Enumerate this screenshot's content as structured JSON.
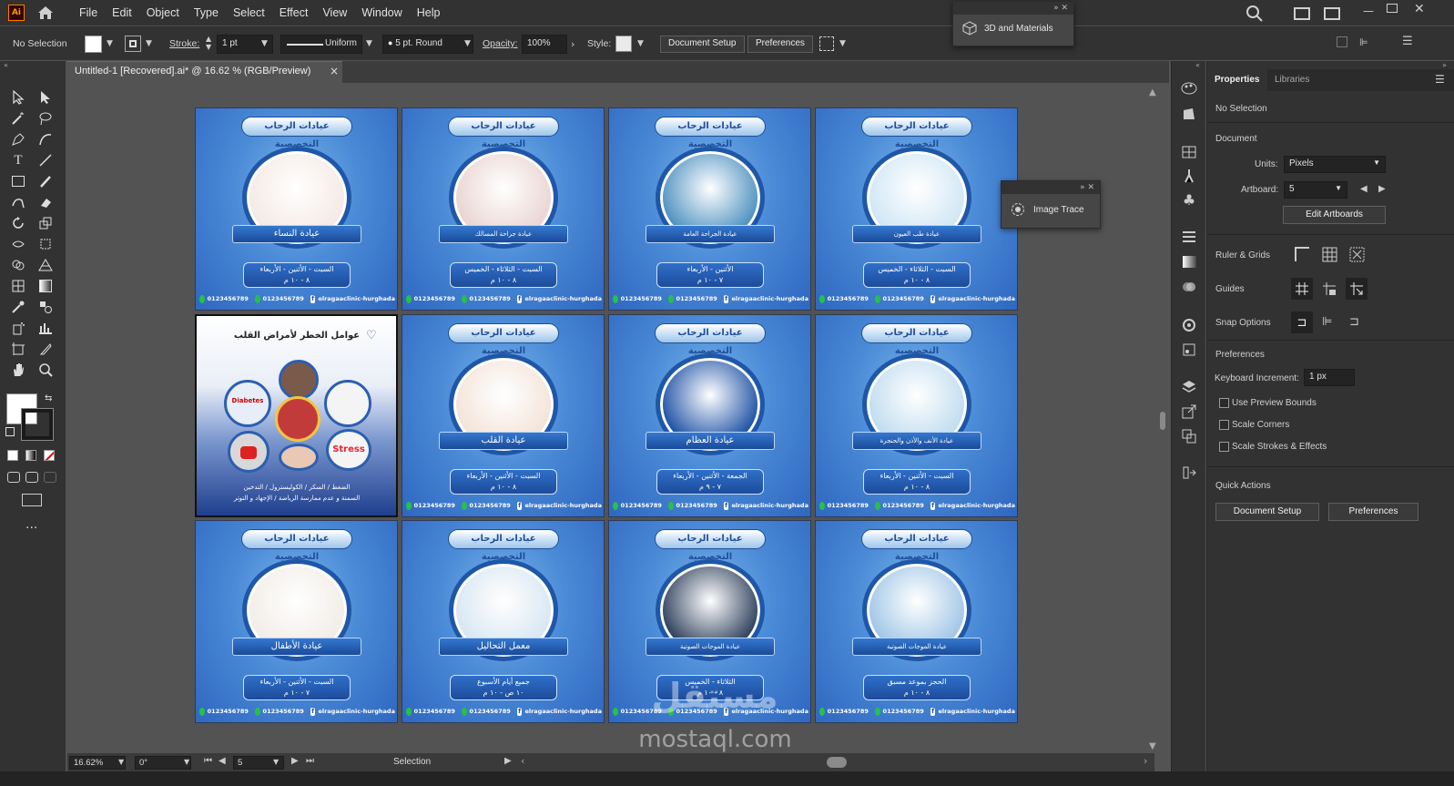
{
  "app": {
    "logo": "Ai"
  },
  "menu": [
    "File",
    "Edit",
    "Object",
    "Type",
    "Select",
    "Effect",
    "View",
    "Window",
    "Help"
  ],
  "control": {
    "selection": "No Selection",
    "stroke_label": "Stroke:",
    "stroke_value": "1 pt",
    "uniform": "Uniform",
    "brush": "5 pt. Round",
    "opacity_label": "Opacity:",
    "opacity_value": "100%",
    "style_label": "Style:",
    "document_setup": "Document Setup",
    "preferences": "Preferences"
  },
  "floating": {
    "panel_3d": "3D and Materials",
    "image_trace": "Image Trace"
  },
  "document_tab": {
    "title": "Untitled-1 [Recovered].ai* @ 16.62 % (RGB/Preview)",
    "close": "×"
  },
  "properties": {
    "tabs": [
      "Properties",
      "Libraries"
    ],
    "selection": "No Selection",
    "document_header": "Document",
    "units_label": "Units:",
    "units_value": "Pixels",
    "artboard_label": "Artboard:",
    "artboard_value": "5",
    "edit_artboards": "Edit Artboards",
    "ruler_grids": "Ruler & Grids",
    "guides": "Guides",
    "snap_options": "Snap Options",
    "preferences_header": "Preferences",
    "keyboard_increment_label": "Keyboard Increment:",
    "keyboard_increment_value": "1 px",
    "use_preview_bounds": "Use Preview Bounds",
    "scale_corners": "Scale Corners",
    "scale_strokes": "Scale Strokes & Effects",
    "quick_actions": "Quick Actions",
    "qa_document_setup": "Document Setup",
    "qa_preferences": "Preferences"
  },
  "cards": [
    {
      "title": "عيادات الرحاب التخصصية",
      "label": "عيادة النساء",
      "sched1": "السبت - الأثنين - الأربعاء",
      "sched2": "٨ - ١٠ م",
      "phone1": "0123456789",
      "phone2": "0123456789",
      "fb": "elragaaclinic-hurghada",
      "color": "#f4e9e4"
    },
    {
      "title": "عيادات الرحاب التخصصية",
      "label": "عيادة جراحة المسالك",
      "sched1": "السبت - الثلاثاء - الخميس",
      "sched2": "٨ - ١٠ م",
      "phone1": "0123456789",
      "phone2": "0123456789",
      "fb": "elragaaclinic-hurghada",
      "color": "#e9d4d0",
      "small": true
    },
    {
      "title": "عيادات الرحاب التخصصية",
      "label": "عيادة الجراحة العامة",
      "sched1": "الأثنين - الأربعاء",
      "sched2": "٧ - ١٠ م",
      "phone1": "0123456789",
      "phone2": "0123456789",
      "fb": "elragaaclinic-hurghada",
      "color": "#4b8fbf",
      "small": true
    },
    {
      "title": "عيادات الرحاب التخصصية",
      "label": "عيادة طب العيون",
      "sched1": "السبت - الثلاثاء - الخميس",
      "sched2": "٨ - ١٠ م",
      "phone1": "0123456789",
      "phone2": "0123456789",
      "fb": "elragaaclinic-hurghada",
      "color": "#cfe6f5",
      "small": true
    },
    {
      "special": true,
      "title": "عوامل الخطر لأمراض القلب",
      "tag1": "Diabetes",
      "tag2": "Stress",
      "line1": "الضغط / السكر / الكوليسترول / التدخين",
      "line2": "السمنة و عدم ممارسة الرياضة / الإجهاد و التوتر"
    },
    {
      "title": "عيادات الرحاب التخصصية",
      "label": "عيادة القلب",
      "sched1": "السبت - الأثنين - الأربعاء",
      "sched2": "٨ - ١٠ م",
      "phone1": "0123456789",
      "phone2": "0123456789",
      "fb": "elragaaclinic-hurghada",
      "color": "#f3e3d8"
    },
    {
      "title": "عيادات الرحاب التخصصية",
      "label": "عيادة العظام",
      "sched1": "الجمعة - الأثنين - الأربعاء",
      "sched2": "٧ - ٩ م",
      "phone1": "0123456789",
      "phone2": "0123456789",
      "fb": "elragaaclinic-hurghada",
      "color": "#1b4fa3"
    },
    {
      "title": "عيادات الرحاب التخصصية",
      "label": "عيادة الأنف والأذن والحنجرة",
      "sched1": "السبت - الأثنين - الأربعاء",
      "sched2": "٨ - ١٠ م",
      "phone1": "0123456789",
      "phone2": "0123456789",
      "fb": "elragaaclinic-hurghada",
      "color": "#bfdcef",
      "small": true
    },
    {
      "title": "عيادات الرحاب التخصصية",
      "label": "عيادة الأطفال",
      "sched1": "السبت - الأثنين - الأربعاء",
      "sched2": "٧ - ١٠ م",
      "phone1": "0123456789",
      "phone2": "0123456789",
      "fb": "elragaaclinic-hurghada",
      "color": "#f1ece6"
    },
    {
      "title": "عيادات الرحاب التخصصية",
      "label": "معمل التحاليل",
      "sched1": "جميع أيام الأسبوع",
      "sched2": "١٠ ص - ١٠ م",
      "phone1": "0123456789",
      "phone2": "0123456789",
      "fb": "elragaaclinic-hurghada",
      "color": "#d7e6f2"
    },
    {
      "title": "عيادات الرحاب التخصصية",
      "label": "عيادة الموجات الصوتية",
      "sched1": "الثلاثاء - الخميس",
      "sched2": "٨ - ١٠ م",
      "phone1": "0123456789",
      "phone2": "0123456789",
      "fb": "elragaaclinic-hurghada",
      "color": "#2c3e5a",
      "small": true
    },
    {
      "title": "عيادات الرحاب التخصصية",
      "label": "عيادة الموجات الصوتية",
      "sched1": "الحجز بموعد مسبق",
      "sched2": "٨ - ١٠ م",
      "phone1": "0123456789",
      "phone2": "0123456789",
      "fb": "elragaaclinic-hurghada",
      "color": "#9fc5e6",
      "small": true
    }
  ],
  "status": {
    "zoom": "16.62%",
    "rotation": "0°",
    "artboard": "5",
    "tool": "Selection"
  },
  "watermark": {
    "line1": "مستقل",
    "line2": "mostaql.com"
  }
}
